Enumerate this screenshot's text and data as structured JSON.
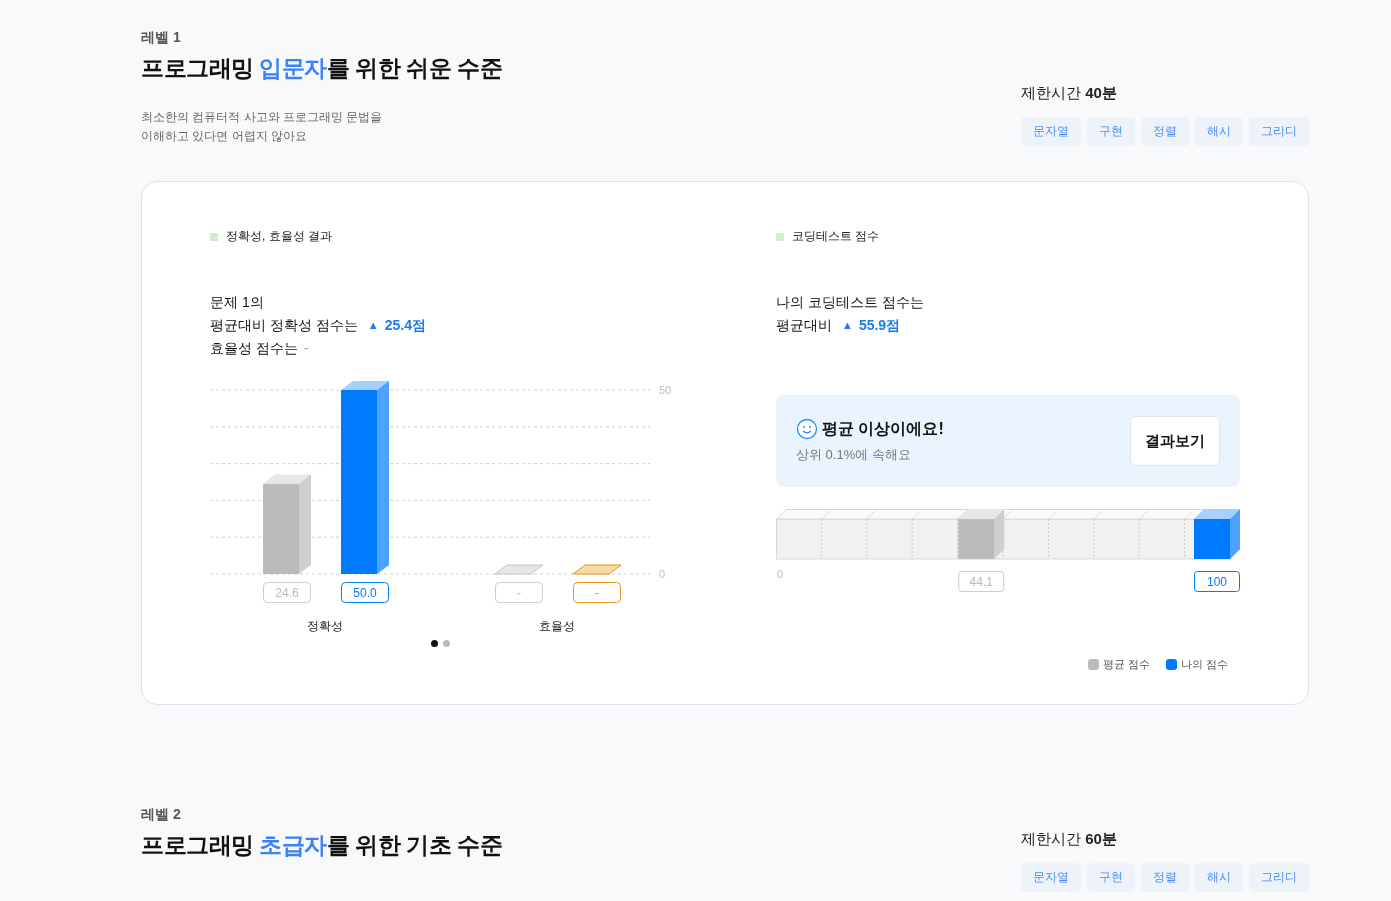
{
  "levels": [
    {
      "label": "레벨 1",
      "title": {
        "before": "프로그래밍 ",
        "highlight": "입문자",
        "after": "를 위한 쉬운 수준"
      },
      "description": [
        "최소한의 컴퓨터적 사고와 프로그래밍 문법을",
        "이해하고 있다면 어렵지 않아요"
      ],
      "time_limit": {
        "label": "제한시간",
        "value": "40분"
      },
      "tags": [
        "문자열",
        "구현",
        "정렬",
        "해시",
        "그리디"
      ],
      "result": {
        "accuracy": {
          "section_title": "정확성, 효율성 결과",
          "heading": [
            {
              "text": "문제 1의"
            },
            {
              "text": "평균대비 정확성 점수는",
              "arrow": "▲",
              "delta": "25.4점"
            },
            {
              "text": "효율성 점수는",
              "delta": "-"
            }
          ],
          "chart_data": {
            "type": "bar",
            "categories": [
              "정확성",
              "효율성"
            ],
            "ylim": [
              0,
              50
            ],
            "yticks": [
              {
                "value": 0,
                "label": "0"
              },
              {
                "value": 50,
                "label": "50"
              }
            ],
            "series": [
              {
                "color": "#bbbbbb",
                "values": [
                  24.6,
                  null
                ],
                "value_labels": [
                  "24.6",
                  "-"
                ]
              },
              {
                "color": "#007aff",
                "values": [
                  50.0,
                  null
                ],
                "value_labels": [
                  "50.0",
                  "-"
                ]
              }
            ]
          },
          "pager": [
            {
              "selected": true
            },
            {
              "selected": false
            }
          ]
        },
        "score": {
          "section_title": "코딩테스트 점수",
          "heading": [
            {
              "text": "나의 코딩테스트 점수는"
            },
            {
              "text": "평균대비",
              "arrow": "▲",
              "delta": "55.9점"
            }
          ],
          "summary": {
            "title": "평균 이상이에요!",
            "subtitle": "상위 0.1%에 속해요",
            "button": "결과보기"
          },
          "scale": {
            "start_label": "0",
            "markers": [
              {
                "name": "평균 점수",
                "color": "#bbbbbb",
                "level": 0.441,
                "label": "44.1"
              },
              {
                "name": "나의 점수",
                "color": "#007aff",
                "level": 1.0,
                "label": "100"
              }
            ]
          }
        }
      }
    },
    {
      "label": "레벨 2",
      "title": {
        "before": "프로그래밍 ",
        "highlight": "초급자",
        "after": "를 위한 기초 수준"
      },
      "time_limit": {
        "label": "제한시간",
        "value": "60분"
      },
      "tags": [
        "문자열",
        "구현",
        "정렬",
        "해시",
        "그리디"
      ]
    }
  ]
}
